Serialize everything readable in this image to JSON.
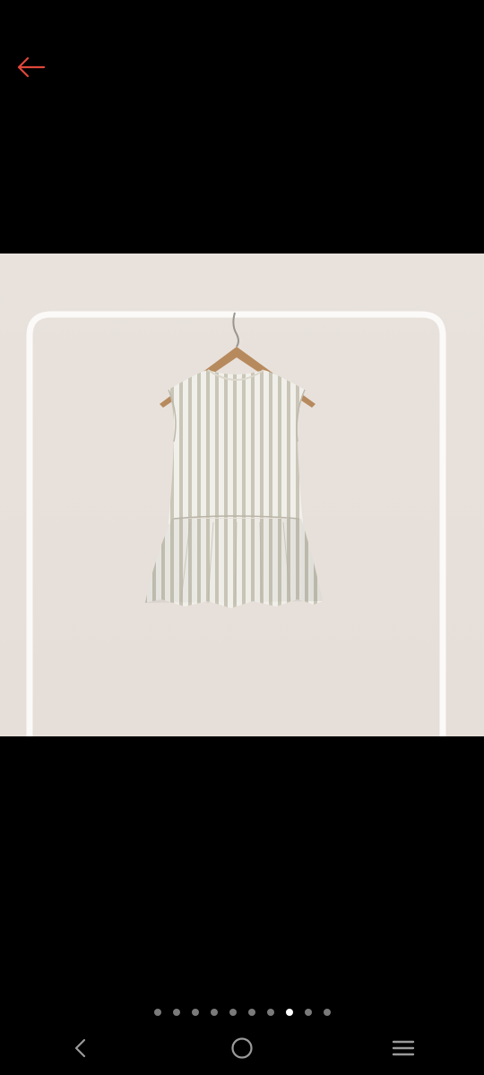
{
  "header": {
    "back_icon": "arrow-left-icon",
    "accent_color": "#e0473a"
  },
  "gallery": {
    "image_description_icon": "product-photo",
    "total_images": 10,
    "active_index": 7,
    "background_color": "#e8e1db"
  },
  "system_nav": {
    "back_icon": "chevron-left-icon",
    "home_icon": "circle-home-icon",
    "menu_icon": "menu-lines-icon"
  }
}
